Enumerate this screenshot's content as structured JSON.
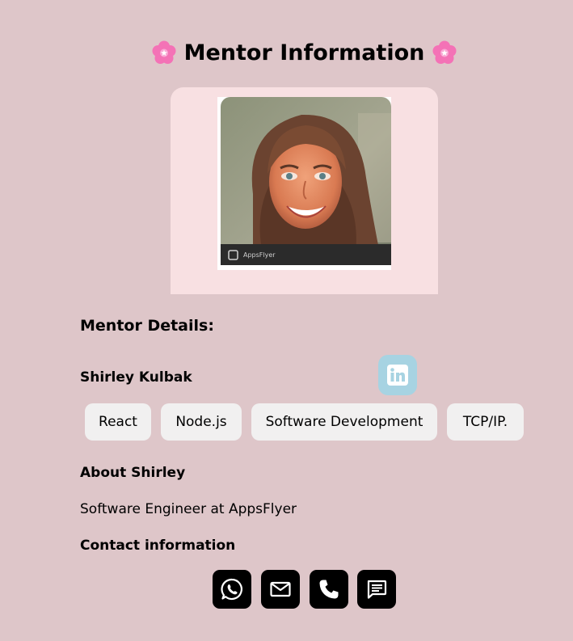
{
  "header": {
    "title": "Mentor Information",
    "decoration_icon": "cherry-blossom-icon"
  },
  "photo": {
    "caption": "AppsFlyer"
  },
  "details": {
    "heading": "Mentor Details:",
    "name": "Shirley Kulbak",
    "linkedin_icon": "linkedin-icon",
    "skills": [
      "React",
      "Node.js",
      "Software Development",
      "TCP/IP."
    ]
  },
  "about": {
    "heading": "About Shirley",
    "text": "Software Engineer at AppsFlyer"
  },
  "contact": {
    "heading": "Contact information",
    "icons": [
      "whatsapp-icon",
      "email-icon",
      "phone-icon",
      "message-icon"
    ]
  },
  "colors": {
    "page_background": "#dec6c9",
    "photo_card_background": "#f8e0e2",
    "linkedin_button": "#a7d3e2",
    "chip_background": "#f1f0f0",
    "contact_button": "#000000",
    "flower": "#f472b6"
  }
}
